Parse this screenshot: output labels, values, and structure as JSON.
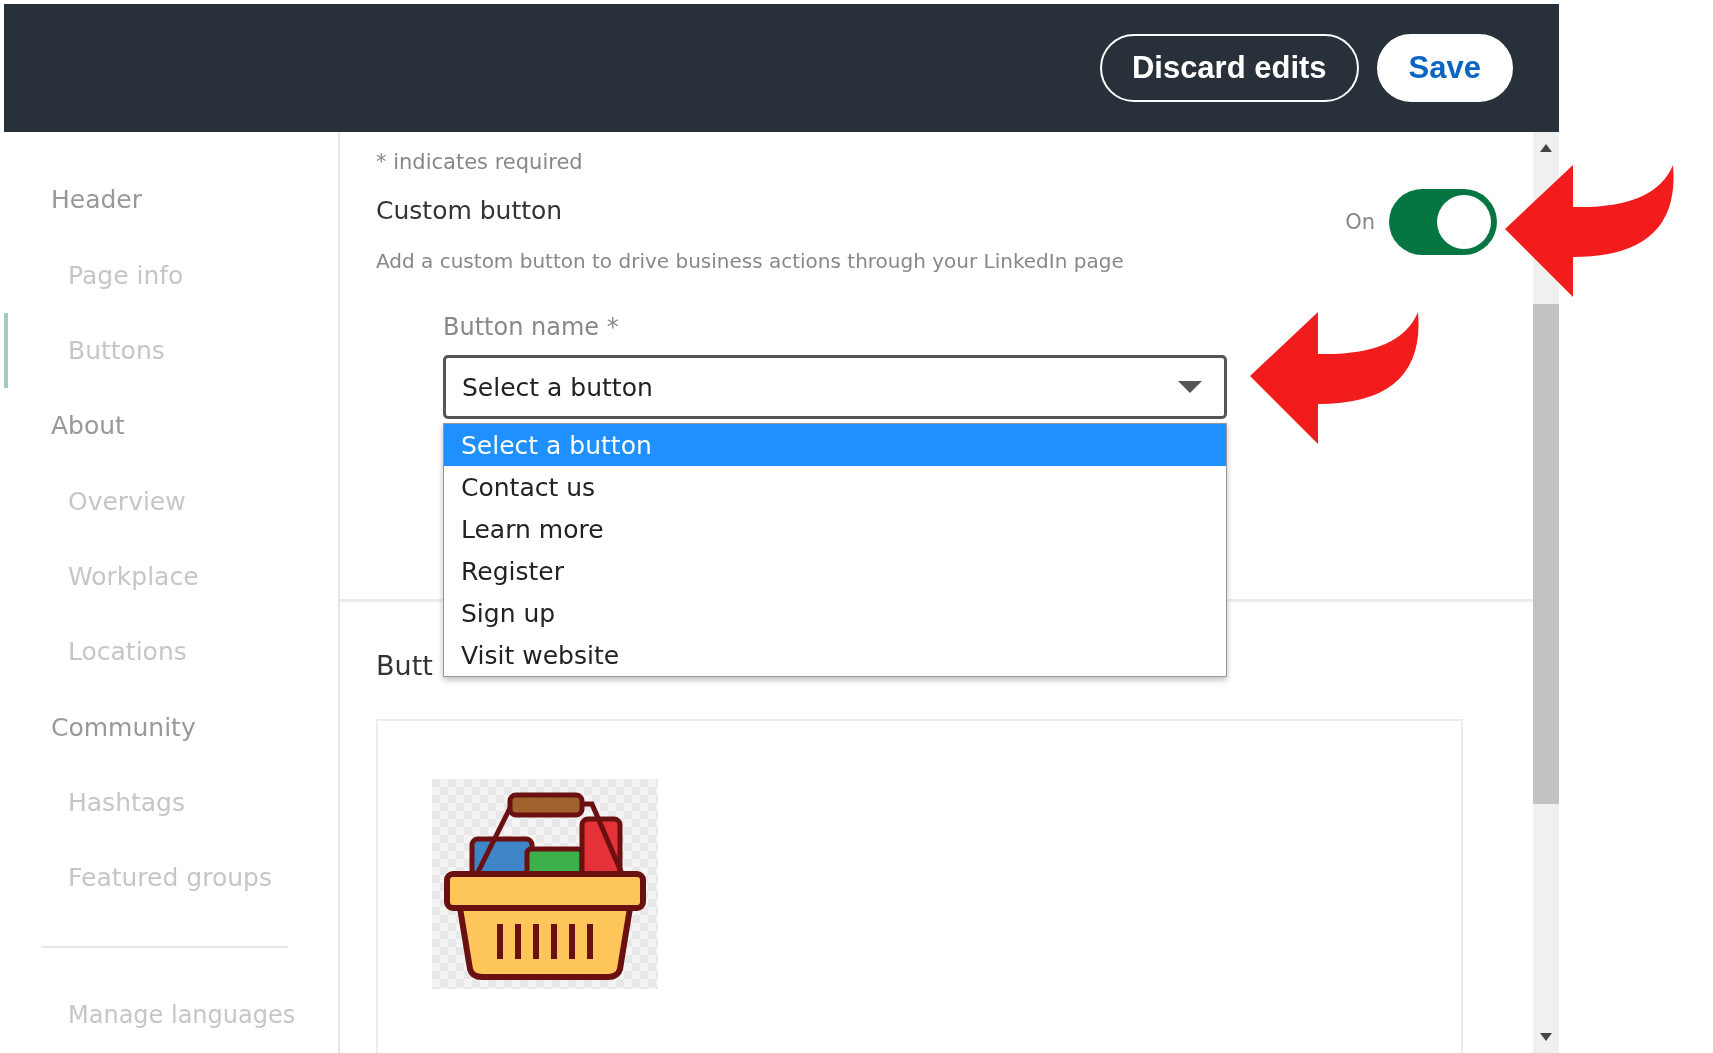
{
  "top_bar": {
    "buttons": [
      {
        "label": "Discard edits",
        "kind": "secondary"
      },
      {
        "label": "Save",
        "kind": "primary"
      }
    ]
  },
  "sidebar": {
    "items": [
      {
        "label": "Header",
        "kind": "section",
        "selected": false
      },
      {
        "label": "Page info",
        "kind": "sub",
        "selected": false
      },
      {
        "label": "Buttons",
        "kind": "sub",
        "selected": true
      },
      {
        "label": "About",
        "kind": "section",
        "selected": false
      },
      {
        "label": "Overview",
        "kind": "sub",
        "selected": false
      },
      {
        "label": "Workplace",
        "kind": "sub",
        "selected": false
      },
      {
        "label": "Locations",
        "kind": "sub",
        "selected": false
      },
      {
        "label": "Community",
        "kind": "section",
        "selected": false
      },
      {
        "label": "Hashtags",
        "kind": "sub",
        "selected": false
      },
      {
        "label": "Featured groups",
        "kind": "sub",
        "selected": false
      },
      {
        "label": "Manage languages",
        "kind": "footer",
        "selected": false
      }
    ]
  },
  "form": {
    "required_note": "* indicates required",
    "title": "Custom button",
    "description": "Add a custom button to drive business actions through your LinkedIn page",
    "toggle": {
      "label": "On",
      "on": true
    },
    "field": {
      "label": "Button name *",
      "value": "Select a button",
      "options": [
        {
          "label": "Select a button",
          "selected": true
        },
        {
          "label": "Contact us",
          "selected": false
        },
        {
          "label": "Learn more",
          "selected": false
        },
        {
          "label": "Register",
          "selected": false
        },
        {
          "label": "Sign up",
          "selected": false
        },
        {
          "label": "Visit website",
          "selected": false
        }
      ]
    }
  },
  "preview": {
    "heading": "Butt"
  }
}
